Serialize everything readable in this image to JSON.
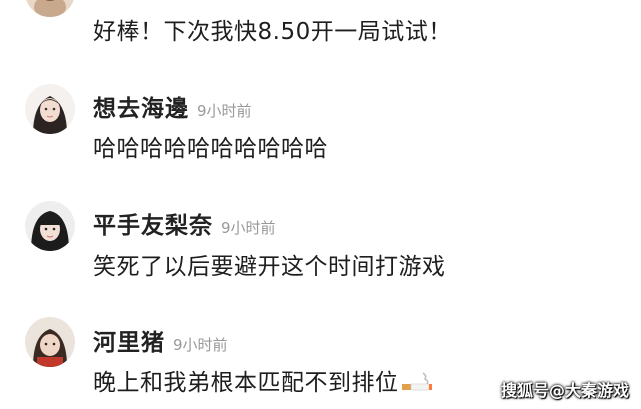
{
  "comments": [
    {
      "name": "",
      "time": "",
      "text": "好棒！下次我快8.50开一局试试！",
      "avatar_icon": "user-avatar-icon"
    },
    {
      "name": "想去海邊",
      "time": "9小时前",
      "text": "哈哈哈哈哈哈哈哈哈哈",
      "avatar_icon": "user-avatar-icon"
    },
    {
      "name": "平手友梨奈",
      "time": "9小时前",
      "text": "笑死了以后要避开这个时间打游戏",
      "avatar_icon": "user-avatar-icon"
    },
    {
      "name": "河里猪",
      "time": "9小时前",
      "text": "晚上和我弟根本匹配不到排位",
      "avatar_icon": "user-avatar-icon",
      "emoji": "cigarette-emoji"
    }
  ],
  "watermark": "搜狐号@大秦游戏",
  "colors": {
    "name": "#222222",
    "time": "#999999",
    "text": "#1e1e1e",
    "background": "#ffffff"
  }
}
